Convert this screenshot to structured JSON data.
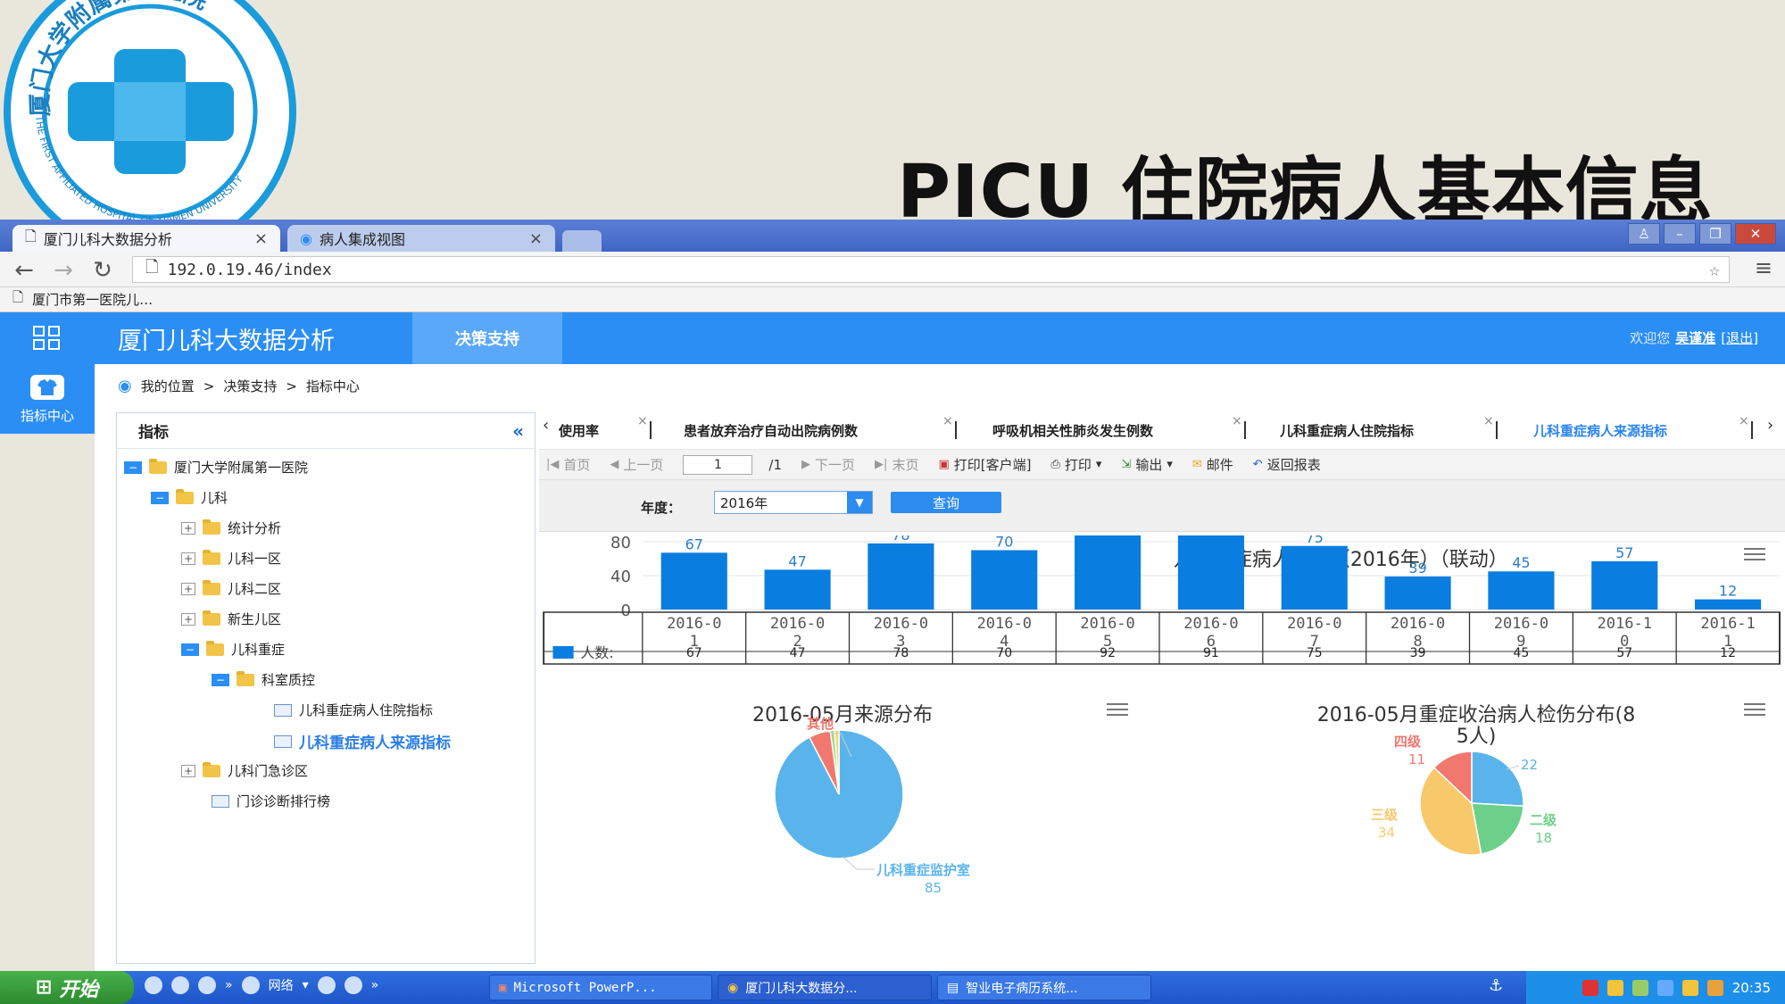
{
  "slide": {
    "title": "PICU 住院病人基本信息",
    "logo": {
      "top_text": "厦门大学附属第一医院",
      "bottom_text": "THE FIRST AFFILIATED HOSPITAL OF XIAMEN UNIVERSITY",
      "primary_color": "#1a9bdc"
    }
  },
  "browser": {
    "tabs": [
      {
        "label": "厦门儿科大数据分析",
        "active": true
      },
      {
        "label": "病人集成视图",
        "active": false
      }
    ],
    "url": "192.0.19.46/index",
    "bookmark": "厦门市第一医院儿…"
  },
  "app": {
    "title": "厦门儿科大数据分析",
    "nav": "决策支持",
    "welcome": "欢迎您",
    "user": "吴谨准",
    "logout": "[退出]",
    "side_label": "指标中心",
    "accent": "#2b8ef5",
    "breadcrumb": [
      "我的位置",
      "决策支持",
      "指标中心"
    ],
    "tree": {
      "header": "指标",
      "nodes": [
        "厦门大学附属第一医院",
        "儿科",
        "统计分析",
        "儿科一区",
        "儿科二区",
        "新生儿区",
        "儿科重症",
        "科室质控",
        "儿科重症病人住院指标",
        "儿科重症病人来源指标",
        "儿科门急诊区",
        "门诊诊断排行榜"
      ]
    },
    "report_tabs": [
      "使用率",
      "患者放弃治疗自动出院病例数",
      "呼吸机相关性肺炎发生例数",
      "儿科重症病人住院指标",
      "儿科重症病人来源指标"
    ],
    "toolbar": {
      "first": "首页",
      "prev": "上一页",
      "page": "1",
      "total": "/1",
      "next": "下一页",
      "last": "末页",
      "print_client": "打印[客户端]",
      "print": "打印",
      "export": "输出",
      "mail": "邮件",
      "back": "返回报表"
    },
    "filter": {
      "year_label": "年度：",
      "year_value": "2016年",
      "query": "查询"
    }
  },
  "chart_data": [
    {
      "type": "bar",
      "title": "儿科重症病人来源（2016年）（联动）",
      "categories": [
        "2016-01",
        "2016-02",
        "2016-03",
        "2016-04",
        "2016-05",
        "2016-06",
        "2016-07",
        "2016-08",
        "2016-09",
        "2016-10",
        "2016-11"
      ],
      "category_lines": [
        [
          "2016-0",
          "1"
        ],
        [
          "2016-0",
          "2"
        ],
        [
          "2016-0",
          "3"
        ],
        [
          "2016-0",
          "4"
        ],
        [
          "2016-0",
          "5"
        ],
        [
          "2016-0",
          "6"
        ],
        [
          "2016-0",
          "7"
        ],
        [
          "2016-0",
          "8"
        ],
        [
          "2016-0",
          "9"
        ],
        [
          "2016-1",
          "0"
        ],
        [
          "2016-1",
          "1"
        ]
      ],
      "series": [
        {
          "name": "人数:",
          "values": [
            67,
            47,
            78,
            70,
            92,
            91,
            75,
            39,
            45,
            57,
            12
          ],
          "color": "#0a7de0"
        }
      ],
      "yticks": [
        0,
        40,
        80
      ],
      "ylim": [
        0,
        92
      ],
      "data_labels": [
        "67",
        "47",
        "78",
        "70",
        "",
        "",
        "75",
        "39",
        "45",
        "57",
        "12"
      ],
      "grid": true
    },
    {
      "type": "pie",
      "title": "2016-05月来源分布",
      "slices": [
        {
          "label": "儿科重症监护室",
          "value": 85,
          "color": "#5ab4ec"
        },
        {
          "label": "其他",
          "value": 5,
          "color": "#f0786e"
        },
        {
          "label": "",
          "value": 1,
          "color": "#a7d88a"
        },
        {
          "label": "",
          "value": 1,
          "color": "#f7d56e"
        }
      ],
      "label_texts": [
        "85",
        "5",
        "儿科重症监护室",
        "其他"
      ]
    },
    {
      "type": "pie",
      "title": "2016-05月重症收治病人检伤分布(85人)",
      "title_lines": [
        "2016-05月重症收治病人检伤分布(8",
        "5人)"
      ],
      "slices": [
        {
          "label": "",
          "value": 22,
          "color": "#5ab4ec"
        },
        {
          "label": "二级",
          "value": 18,
          "color": "#6dd08a"
        },
        {
          "label": "三级",
          "value": 34,
          "color": "#f8c96a"
        },
        {
          "label": "四级",
          "value": 11,
          "color": "#f0786e"
        }
      ],
      "label_texts": [
        "22",
        "18",
        "34",
        "11",
        "二级",
        "三级",
        "四级"
      ]
    }
  ],
  "taskbar": {
    "start": "开始",
    "network": "网络",
    "items": [
      "Microsoft PowerP...",
      "厦门儿科大数据分...",
      "智业电子病历系统..."
    ],
    "clock": "20:35"
  }
}
